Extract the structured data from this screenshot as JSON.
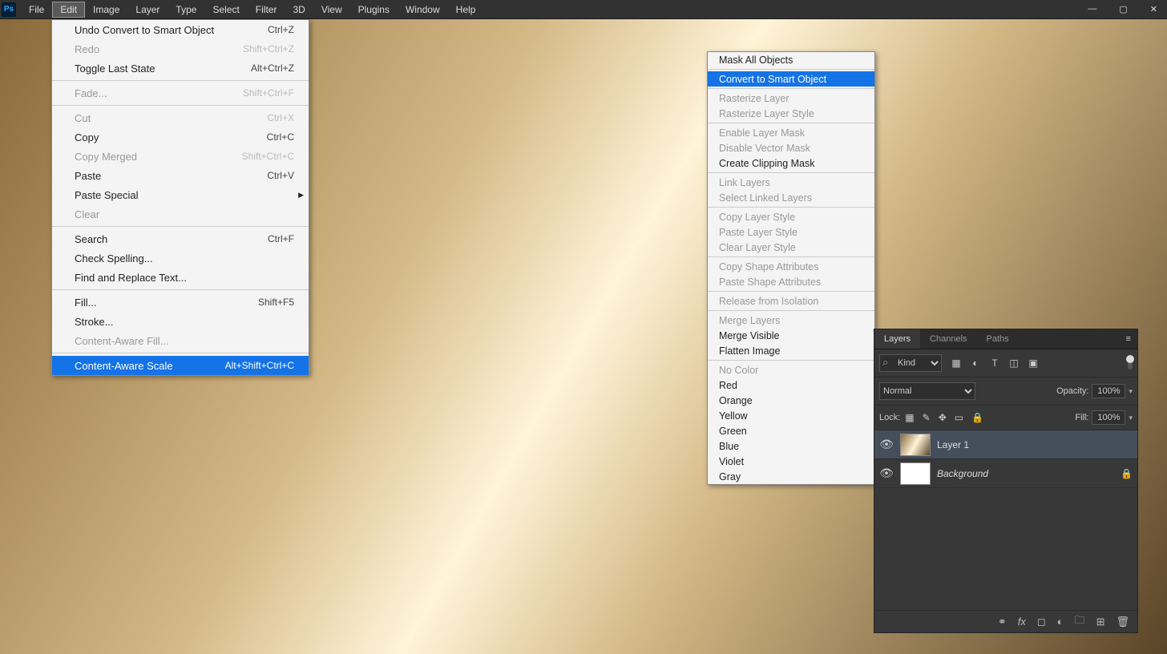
{
  "menubar": [
    "File",
    "Edit",
    "Image",
    "Layer",
    "Type",
    "Select",
    "Filter",
    "3D",
    "View",
    "Plugins",
    "Window",
    "Help"
  ],
  "menubar_active": "Edit",
  "edit_menu": [
    {
      "label": "Undo Convert to Smart Object",
      "kbd": "Ctrl+Z"
    },
    {
      "label": "Redo",
      "kbd": "Shift+Ctrl+Z",
      "disabled": true
    },
    {
      "label": "Toggle Last State",
      "kbd": "Alt+Ctrl+Z"
    },
    {
      "sep": true
    },
    {
      "label": "Fade...",
      "kbd": "Shift+Ctrl+F",
      "disabled": true
    },
    {
      "sep": true
    },
    {
      "label": "Cut",
      "kbd": "Ctrl+X",
      "disabled": true
    },
    {
      "label": "Copy",
      "kbd": "Ctrl+C"
    },
    {
      "label": "Copy Merged",
      "kbd": "Shift+Ctrl+C",
      "disabled": true
    },
    {
      "label": "Paste",
      "kbd": "Ctrl+V"
    },
    {
      "label": "Paste Special",
      "submenu": true
    },
    {
      "label": "Clear",
      "disabled": true
    },
    {
      "sep": true
    },
    {
      "label": "Search",
      "kbd": "Ctrl+F"
    },
    {
      "label": "Check Spelling..."
    },
    {
      "label": "Find and Replace Text..."
    },
    {
      "sep": true
    },
    {
      "label": "Fill...",
      "kbd": "Shift+F5"
    },
    {
      "label": "Stroke..."
    },
    {
      "label": "Content-Aware Fill...",
      "disabled": true
    },
    {
      "sep": true
    },
    {
      "label": "Content-Aware Scale",
      "kbd": "Alt+Shift+Ctrl+C",
      "highlight": true
    }
  ],
  "context_menu": [
    {
      "label": "Mask All Objects"
    },
    {
      "sep": true
    },
    {
      "label": "Convert to Smart Object",
      "highlight": true
    },
    {
      "sep": true
    },
    {
      "label": "Rasterize Layer",
      "disabled": true
    },
    {
      "label": "Rasterize Layer Style",
      "disabled": true
    },
    {
      "sep": true
    },
    {
      "label": "Enable Layer Mask",
      "disabled": true
    },
    {
      "label": "Disable Vector Mask",
      "disabled": true
    },
    {
      "label": "Create Clipping Mask"
    },
    {
      "sep": true
    },
    {
      "label": "Link Layers",
      "disabled": true
    },
    {
      "label": "Select Linked Layers",
      "disabled": true
    },
    {
      "sep": true
    },
    {
      "label": "Copy Layer Style",
      "disabled": true
    },
    {
      "label": "Paste Layer Style",
      "disabled": true
    },
    {
      "label": "Clear Layer Style",
      "disabled": true
    },
    {
      "sep": true
    },
    {
      "label": "Copy Shape Attributes",
      "disabled": true
    },
    {
      "label": "Paste Shape Attributes",
      "disabled": true
    },
    {
      "sep": true
    },
    {
      "label": "Release from Isolation",
      "disabled": true
    },
    {
      "sep": true
    },
    {
      "label": "Merge Layers",
      "disabled": true
    },
    {
      "label": "Merge Visible"
    },
    {
      "label": "Flatten Image"
    },
    {
      "sep": true
    },
    {
      "label": "No Color",
      "disabled": true
    },
    {
      "label": "Red"
    },
    {
      "label": "Orange"
    },
    {
      "label": "Yellow"
    },
    {
      "label": "Green"
    },
    {
      "label": "Blue"
    },
    {
      "label": "Violet"
    },
    {
      "label": "Gray"
    }
  ],
  "layers_panel": {
    "tabs": [
      "Layers",
      "Channels",
      "Paths"
    ],
    "active_tab": "Layers",
    "filter_kind": "Kind",
    "blend_mode": "Normal",
    "opacity_label": "Opacity:",
    "opacity": "100%",
    "lock_label": "Lock:",
    "fill_label": "Fill:",
    "fill": "100%",
    "layers": [
      {
        "name": "Layer 1",
        "selected": true
      },
      {
        "name": "Background",
        "bg": true,
        "locked": true
      }
    ]
  },
  "ps_logo": "Ps"
}
